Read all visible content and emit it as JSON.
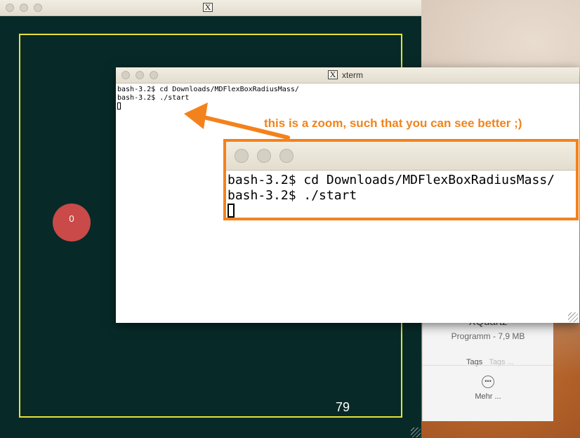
{
  "sim_window": {
    "ball_label": "0",
    "counter": "79"
  },
  "info_panel": {
    "app_name": "XQuartz",
    "app_kind": "Programm - 7,9 MB",
    "tags_label": "Tags",
    "tags_placeholder": "Tags ...",
    "more_label": "Mehr ..."
  },
  "xterm": {
    "title": "xterm",
    "lines": [
      "bash-3.2$ cd Downloads/MDFlexBoxRadiusMass/",
      "bash-3.2$ ./start"
    ]
  },
  "annotation": {
    "text": "this is a zoom, such that you can see better ;)",
    "color": "#f3821c"
  },
  "zoom": {
    "lines": [
      "bash-3.2$ cd Downloads/MDFlexBoxRadiusMass/",
      "bash-3.2$ ./start"
    ]
  },
  "icons": {
    "x11": "X"
  }
}
